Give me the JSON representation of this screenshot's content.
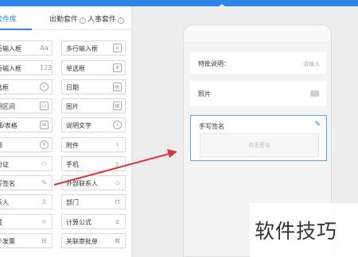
{
  "tabs": [
    {
      "label": "套件库"
    },
    {
      "label": "出勤套件"
    },
    {
      "label": "人事套件"
    }
  ],
  "fields_left": [
    {
      "label": "行输入框",
      "icon": "text-input-icon",
      "glyph": "Aa"
    },
    {
      "label": "行输入框",
      "icon": "number-icon",
      "glyph": "123"
    },
    {
      "label": "选框",
      "icon": "check-circle-icon",
      "glyph": "✓"
    },
    {
      "label": "期区间",
      "icon": "date-range-icon",
      "glyph": "▭"
    },
    {
      "label": "细/表格",
      "icon": "table-icon",
      "glyph": "⊞"
    },
    {
      "label": "额",
      "icon": "currency-icon",
      "glyph": "¥"
    },
    {
      "label": "份证",
      "icon": "id-card-icon",
      "glyph": "⚇"
    },
    {
      "label": "写签名",
      "icon": "pen-icon",
      "glyph": "✎"
    },
    {
      "label": "系人",
      "icon": "person-icon",
      "glyph": "♙"
    },
    {
      "label": "置",
      "icon": "location-icon",
      "glyph": "⌾"
    },
    {
      "label": "于发票",
      "icon": "invoice-icon",
      "glyph": "⊟"
    }
  ],
  "fields_right": [
    {
      "label": "多行输入框",
      "icon": "multiline-icon",
      "glyph": "≡"
    },
    {
      "label": "单选框",
      "icon": "radio-icon",
      "glyph": "≣"
    },
    {
      "label": "日期",
      "icon": "calendar-icon",
      "glyph": "▤"
    },
    {
      "label": "图片",
      "icon": "image-icon",
      "glyph": "▨"
    },
    {
      "label": "说明文字",
      "icon": "info-icon",
      "glyph": "i"
    },
    {
      "label": "附件",
      "icon": "attachment-icon",
      "glyph": "⌇"
    },
    {
      "label": "手机",
      "icon": "phone-icon",
      "glyph": "▯"
    },
    {
      "label": "外部联系人",
      "icon": "tag-icon",
      "glyph": "◇"
    },
    {
      "label": "部门",
      "icon": "department-icon",
      "glyph": "⊓"
    },
    {
      "label": "计算公式",
      "icon": "formula-icon",
      "glyph": "±"
    },
    {
      "label": "关联审批单",
      "icon": "link-icon",
      "glyph": "⊠"
    }
  ],
  "preview": {
    "row1_label": "特批说明：",
    "row1_placeholder": "请输入",
    "row2_label": "照片",
    "signature_label": "手写签名",
    "signature_placeholder": "点击签名"
  },
  "watermark": "软件技巧",
  "colors": {
    "accent": "#2f86e6",
    "arrow": "#d9363e"
  }
}
